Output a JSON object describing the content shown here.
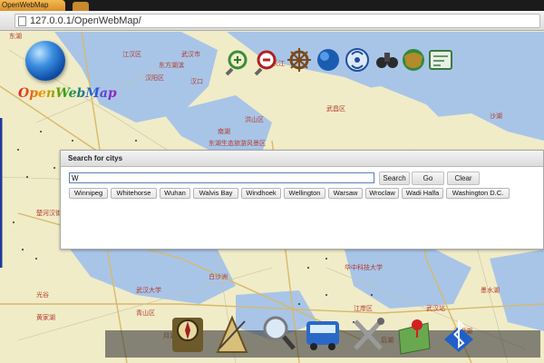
{
  "browser": {
    "tab_title": "OpenWebMap",
    "url": "127.0.0.1/OpenWebMap/"
  },
  "logo": {
    "text": "OpenWebMap"
  },
  "toolbar": {
    "icons": [
      "zoom-in-icon",
      "zoom-out-icon",
      "ship-wheel-icon",
      "globe-icon",
      "gps-icon",
      "binoculars-icon",
      "layers-globe-icon",
      "map-card-icon"
    ]
  },
  "search": {
    "title": "Search for citys",
    "query": "W",
    "search_label": "Search",
    "go_label": "Go",
    "clear_label": "Clear",
    "results": [
      "Winnipeg",
      "Whitehorse",
      "Wuhan",
      "Walvis Bay",
      "Windhoek",
      "Wellington",
      "Warsaw",
      "Wroclaw",
      "Wadi Halfa",
      "Washington D.C."
    ]
  },
  "dock": {
    "icons": [
      "compass-icon",
      "drafting-icon",
      "magnifier-icon",
      "bus-icon",
      "tools-icon",
      "map-pin-icon",
      "bluetooth-icon"
    ]
  },
  "map_labels": [
    "江汉区",
    "东方湖滨",
    "汉口",
    "汉阳区",
    "长江",
    "武昌区",
    "洪山区",
    "沙湖",
    "东湖",
    "南湖",
    "东湖生态旅游风景区",
    "楚河汉街",
    "武汉大学",
    "华中科技大学",
    "光谷",
    "白沙洲",
    "武汉站",
    "江岸区",
    "青山区",
    "汤逊湖",
    "黄家湖",
    "墨水湖",
    "月湖",
    "后湖",
    "武汉市"
  ],
  "colors": {
    "water": "#a8c5e8",
    "land": "#f1ecc8",
    "accent": "#5a7fb8"
  }
}
